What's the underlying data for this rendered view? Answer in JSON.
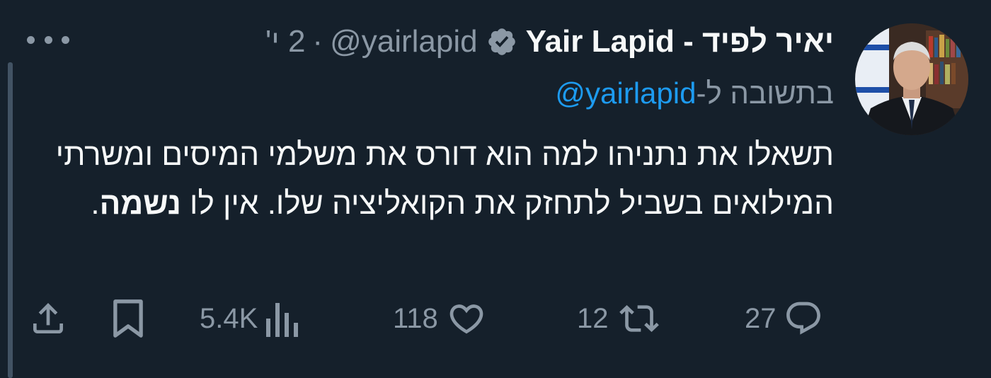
{
  "author": {
    "name": "Yair Lapid - יאיר לפיד",
    "handle": "@yairlapid",
    "separator": "·",
    "time": "2 י'",
    "verified": true
  },
  "reply": {
    "prefix": "בתשובה ל-",
    "mention": "@yairlapid"
  },
  "body": {
    "text": "תשאלו את נתניהו למה הוא דורס את משלמי המיסים ומשרתי המילואים בשביל לתחזק את הקואליציה שלו. אין לו ",
    "bold": "נשמה",
    "end": "."
  },
  "actions": {
    "replies": "27",
    "reposts": "12",
    "likes": "118",
    "views": "5.4K"
  },
  "colors": {
    "background": "#15202b",
    "muted": "#8b98a5",
    "link": "#1d9bf0",
    "text": "#f7f9f9"
  }
}
